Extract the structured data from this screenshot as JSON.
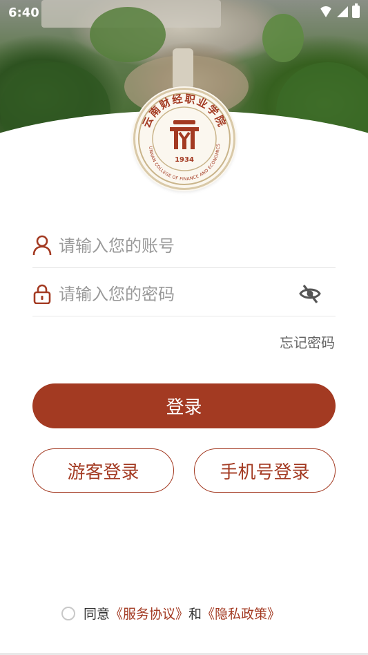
{
  "status_bar": {
    "time": "6:40",
    "icons": [
      "wifi-icon",
      "signal-icon",
      "battery-icon"
    ]
  },
  "logo": {
    "name_text": "云南财经职业学院",
    "english_text": "YUNNAN COLLEGE OF FINANCE AND ECONOMICS",
    "year": "1934"
  },
  "login_form": {
    "account_placeholder": "请输入您的账号",
    "password_placeholder": "请输入您的密码",
    "forgot_label": "忘记密码",
    "login_label": "登录",
    "guest_login_label": "游客登录",
    "phone_login_label": "手机号登录"
  },
  "agreement": {
    "prefix": "同意",
    "service_link": "《服务协议》",
    "conjunction": "和",
    "privacy_link": "《隐私政策》",
    "checked": false
  },
  "colors": {
    "accent": "#a33a22",
    "placeholder": "#9a9a9a",
    "divider": "#e6e6e6"
  }
}
